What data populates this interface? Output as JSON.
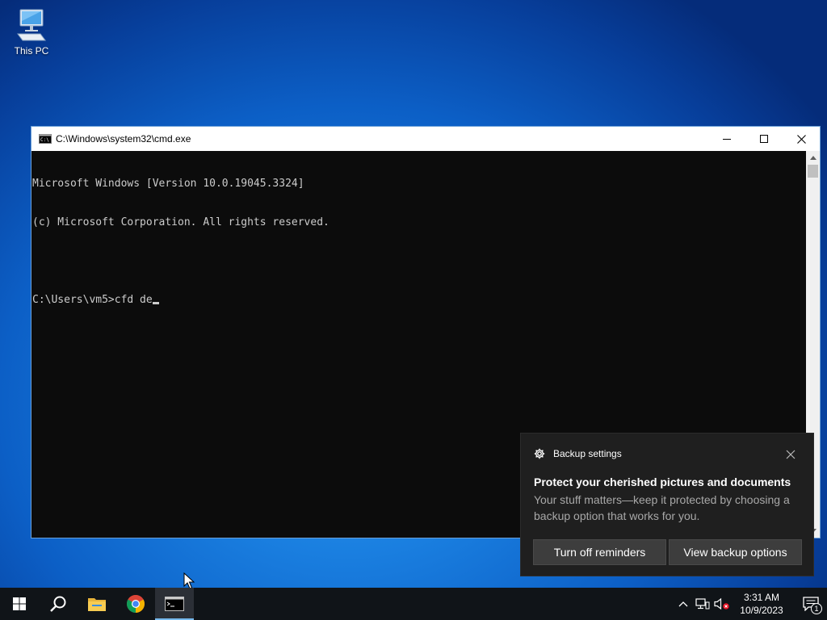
{
  "desktop": {
    "icons": [
      {
        "label": "This PC",
        "icon": "this-pc-icon"
      }
    ]
  },
  "cmd": {
    "title": "C:\\Windows\\system32\\cmd.exe",
    "lines": [
      "Microsoft Windows [Version 10.0.19045.3324]",
      "(c) Microsoft Corporation. All rights reserved.",
      "",
      "C:\\Users\\vm5>cfd de"
    ],
    "controls": [
      "minimize-icon",
      "maximize-icon",
      "close-icon"
    ]
  },
  "toast": {
    "app_name": "Backup settings",
    "title": "Protect your cherished pictures and documents",
    "body": "Your stuff matters—keep it protected by choosing a backup option that works for you.",
    "buttons": {
      "turn_off": "Turn off reminders",
      "view": "View backup options"
    }
  },
  "taskbar": {
    "items": [
      "start-icon",
      "search-icon",
      "file-explorer-icon",
      "chrome-icon",
      "cmd-icon"
    ],
    "active_item": "cmd-icon",
    "clock": {
      "time": "3:31 AM",
      "date": "10/9/2023"
    },
    "notification_count": "1"
  },
  "colors": {
    "taskbar_bg": "#101418",
    "console_bg": "#0c0c0c",
    "console_text": "#cccccc",
    "toast_bg": "#1f1f1f",
    "accent": "#76b9ed"
  }
}
